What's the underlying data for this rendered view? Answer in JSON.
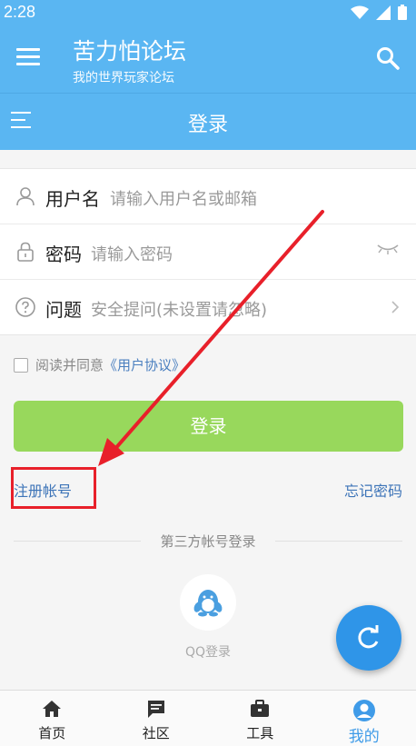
{
  "status_bar": {
    "time": "2:28"
  },
  "app_bar": {
    "title": "苦力怕论坛",
    "subtitle": "我的世界玩家论坛"
  },
  "sub_bar": {
    "title": "登录"
  },
  "form": {
    "username": {
      "label": "用户名",
      "placeholder": "请输入用户名或邮箱"
    },
    "password": {
      "label": "密码",
      "placeholder": "请输入密码"
    },
    "question": {
      "label": "问题",
      "placeholder": "安全提问(未设置请忽略)"
    }
  },
  "agreement": {
    "text": "阅读并同意",
    "link": "《用户协议》"
  },
  "login_button": "登录",
  "register_link": "注册帐号",
  "forgot_link": "忘记密码",
  "third_party": {
    "title": "第三方帐号登录",
    "qq_label": "QQ登录"
  },
  "bottom_nav": [
    {
      "label": "首页",
      "icon": "home-icon"
    },
    {
      "label": "社区",
      "icon": "chat-icon"
    },
    {
      "label": "工具",
      "icon": "toolbox-icon"
    },
    {
      "label": "我的",
      "icon": "profile-icon",
      "active": true
    }
  ],
  "colors": {
    "header": "#5ab6f2",
    "login_button": "#98d85c",
    "link": "#3d74b8",
    "fab": "#2f95e8",
    "annotation": "#e8202a"
  }
}
